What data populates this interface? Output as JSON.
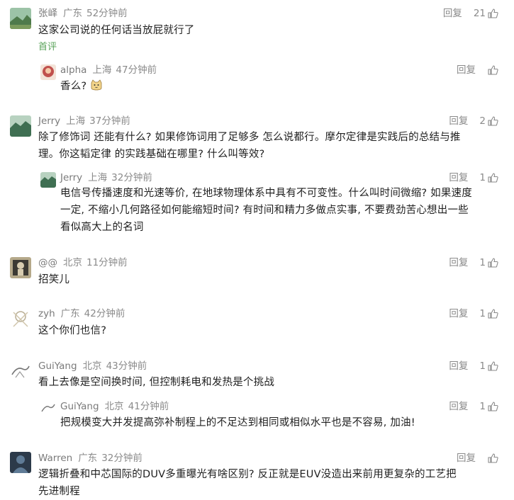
{
  "comments": [
    {
      "name": "张峄",
      "location": "广东",
      "time": "52分钟前",
      "text": "这家公司说的任何话当放屁就行了",
      "badge": "首评",
      "reply_label": "回复",
      "likes": "21",
      "avatar_color": "#6f8f5d"
    },
    {
      "name": "alpha",
      "location": "上海",
      "time": "47分钟前",
      "text": "香么?",
      "reply_label": "回复",
      "likes": "",
      "avatar_color": "#c0504d",
      "nested": true
    },
    {
      "name": "Jerry",
      "location": "上海",
      "time": "37分钟前",
      "text_lines": [
        "除了修饰词 还能有什么? 如果修饰词用了足够多 怎么说都行。摩尔定律是实践后的总结与推",
        "理。你这韬定律 的实践基础在哪里? 什么叫等效?"
      ],
      "reply_label": "回复",
      "likes": "2",
      "avatar_color": "#5e8c6a"
    },
    {
      "name": "Jerry",
      "location": "上海",
      "time": "32分钟前",
      "text_lines": [
        "电信号传播速度和光速等价, 在地球物理体系中具有不可变性。什么叫时间微缩? 如果速度",
        "一定, 不缩小几何路径如何能缩短时间? 有时间和精力多做点实事, 不要费劲苦心想出一些",
        "看似高大上的名词"
      ],
      "reply_label": "回复",
      "likes": "1",
      "avatar_color": "#5e8c6a",
      "nested": true
    },
    {
      "name": "@@",
      "location": "北京",
      "time": "11分钟前",
      "text": "招笑儿",
      "reply_label": "回复",
      "likes": "1",
      "avatar_color": "#8a7a5a"
    },
    {
      "name": "zyh",
      "location": "广东",
      "time": "42分钟前",
      "text": "这个你们也信?",
      "reply_label": "回复",
      "likes": "1",
      "avatar_color": "#d9d3c4"
    },
    {
      "name": "GuiYang",
      "location": "北京",
      "time": "43分钟前",
      "text": "看上去像是空间换时间, 但控制耗电和发热是个挑战",
      "reply_label": "回复",
      "likes": "1",
      "avatar_color": "#c9c9c9"
    },
    {
      "name": "GuiYang",
      "location": "北京",
      "time": "41分钟前",
      "text": "把规模变大并发提高弥补制程上的不足达到相同或相似水平也是不容易, 加油!",
      "reply_label": "回复",
      "likes": "1",
      "avatar_color": "#c9c9c9",
      "nested": true
    },
    {
      "name": "Warren",
      "location": "广东",
      "time": "32分钟前",
      "text_lines": [
        "逻辑折叠和中芯国际的DUV多重曝光有啥区别? 反正就是EUV没造出来前用更复杂的工艺把",
        "先进制程"
      ],
      "reply_label": "回复",
      "likes": "",
      "avatar_color": "#3a4a5a"
    }
  ]
}
